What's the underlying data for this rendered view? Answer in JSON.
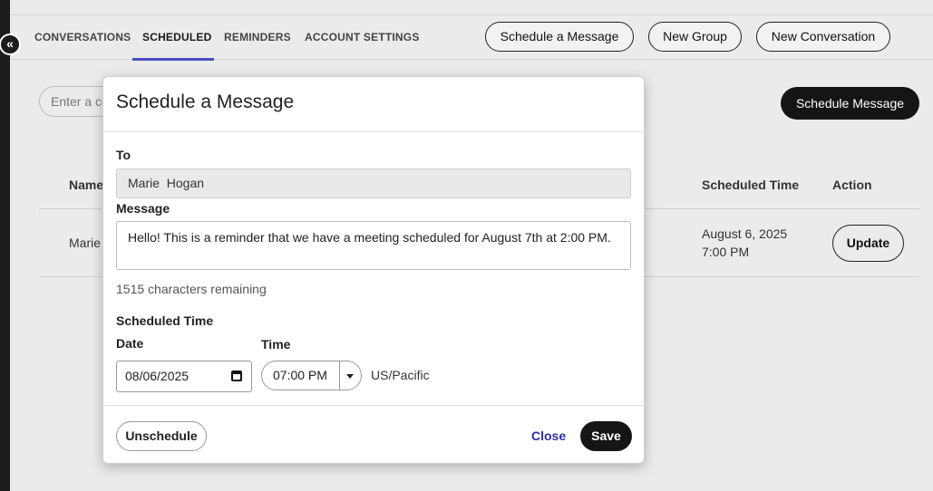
{
  "nav": {
    "tabs": [
      {
        "label": "CONVERSATIONS"
      },
      {
        "label": "SCHEDULED"
      },
      {
        "label": "REMINDERS"
      },
      {
        "label": "ACCOUNT SETTINGS"
      }
    ],
    "active_tab": "SCHEDULED",
    "buttons": {
      "schedule_message": "Schedule a Message",
      "new_group": "New Group",
      "new_conversation": "New Conversation"
    }
  },
  "page": {
    "search_placeholder": "Enter a co",
    "schedule_button": "Schedule Message",
    "table": {
      "headers": {
        "name": "Name",
        "scheduled_time": "Scheduled Time",
        "action": "Action"
      },
      "rows": [
        {
          "name": "Marie",
          "scheduled_date": "August 6, 2025",
          "scheduled_clock": "7:00 PM",
          "action": "Update"
        }
      ]
    }
  },
  "modal": {
    "title": "Schedule a Message",
    "to_label": "To",
    "to_value": "Marie  Hogan",
    "message_label": "Message",
    "message_value": "Hello! This is a reminder that we have a meeting scheduled for August 7th at 2:00 PM.",
    "remaining": "1515 characters remaining",
    "scheduled_time_label": "Scheduled Time",
    "date_label": "Date",
    "date_value": "08/06/2025",
    "time_label": "Time",
    "time_value": "07:00 PM",
    "timezone": "US/Pacific",
    "unschedule": "Unschedule",
    "close": "Close",
    "save": "Save"
  },
  "colors": {
    "accent": "#4b4fc4",
    "link": "#2b2fa6",
    "primary_button": "#151515"
  },
  "icons": {
    "collapse": "double-chevron-left-icon",
    "calendar": "calendar-icon",
    "time_dropdown": "caret-down-icon"
  }
}
